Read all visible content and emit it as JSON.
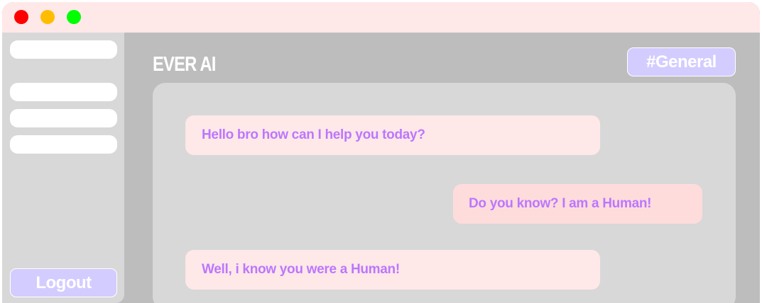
{
  "window": {
    "traffic_lights": [
      "close",
      "minimize",
      "maximize"
    ],
    "colors": {
      "close": "#ff0000",
      "minimize": "#ffbd00",
      "maximize": "#00ff00"
    }
  },
  "sidebar": {
    "items": [
      "",
      "",
      "",
      ""
    ],
    "logout_label": "Logout"
  },
  "header": {
    "title": "EVER AI",
    "channel_label": "#General"
  },
  "chat": {
    "messages": [
      {
        "sender": "bot",
        "text": "Hello bro how can I help you today?"
      },
      {
        "sender": "user",
        "text": "Do you know? I am a Human!"
      },
      {
        "sender": "bot",
        "text": "Well, i know you were a Human!"
      }
    ]
  },
  "colors": {
    "accent": "#d3ccff",
    "message_text": "#bb77ff",
    "titlebar": "#ffe8e8",
    "user_bubble": "#ffdcdc",
    "bot_bubble": "#ffe8e8"
  }
}
